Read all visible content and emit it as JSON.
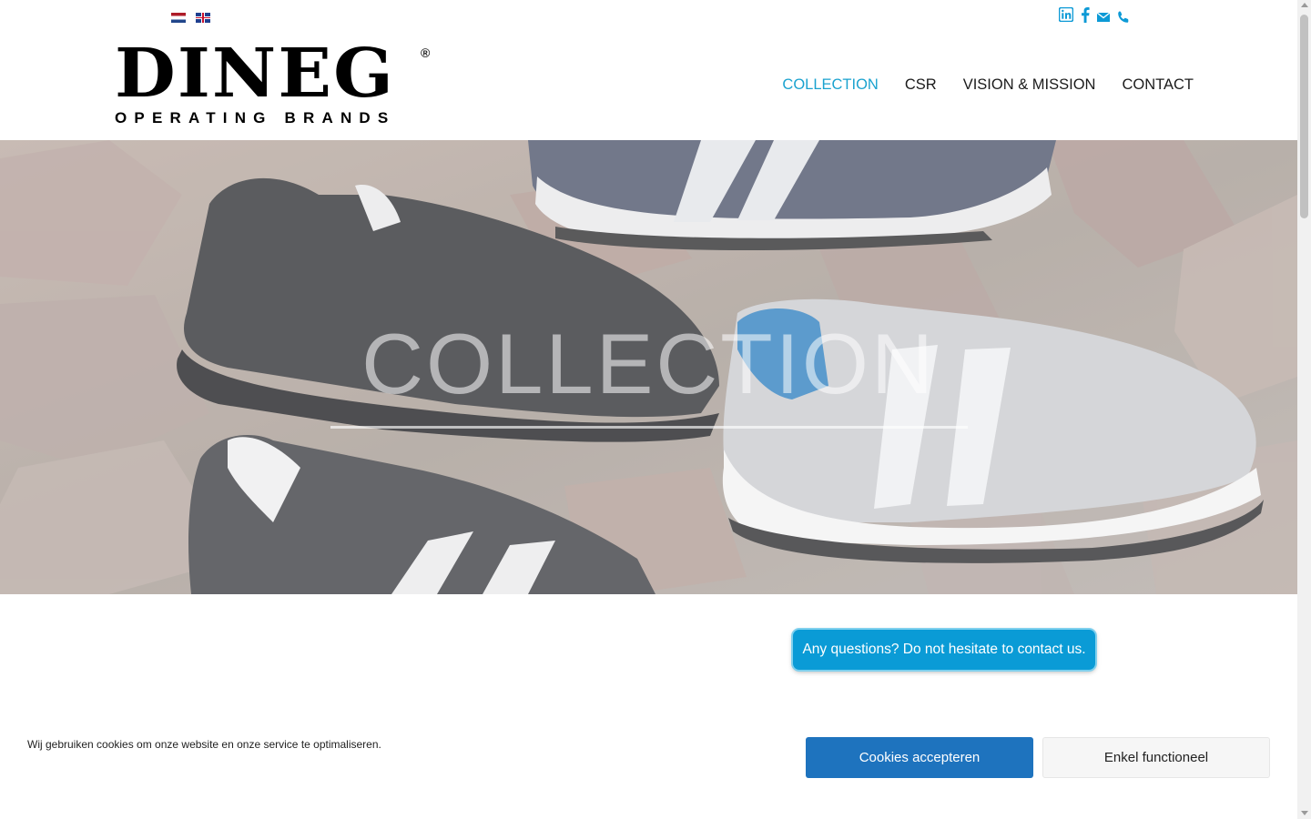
{
  "languages": [
    {
      "name": "dutch-flag-icon",
      "label": "Nederlands"
    },
    {
      "name": "english-flag-icon",
      "label": "English"
    }
  ],
  "social_icons": [
    "linkedin-icon",
    "facebook-icon",
    "email-icon",
    "phone-icon"
  ],
  "brand": {
    "name": "DINEG",
    "registered_mark": "®",
    "tagline": "OPERATING BRANDS"
  },
  "nav": {
    "items": [
      {
        "label": "COLLECTION",
        "active": true
      },
      {
        "label": "CSR",
        "active": false
      },
      {
        "label": "VISION & MISSION",
        "active": false
      },
      {
        "label": "CONTACT",
        "active": false
      }
    ]
  },
  "hero": {
    "title": "COLLECTION"
  },
  "cta": {
    "label": "Any questions? Do not hesitate to contact us."
  },
  "cookie_banner": {
    "message": "Wij gebruiken cookies om onze website en onze service te optimaliseren.",
    "accept_label": "Cookies accepteren",
    "functional_label": "Enkel functioneel"
  },
  "colors": {
    "accent": "#0a9bd6",
    "nav_active": "#1aa2cf",
    "cookie_accept": "#1e73be"
  }
}
